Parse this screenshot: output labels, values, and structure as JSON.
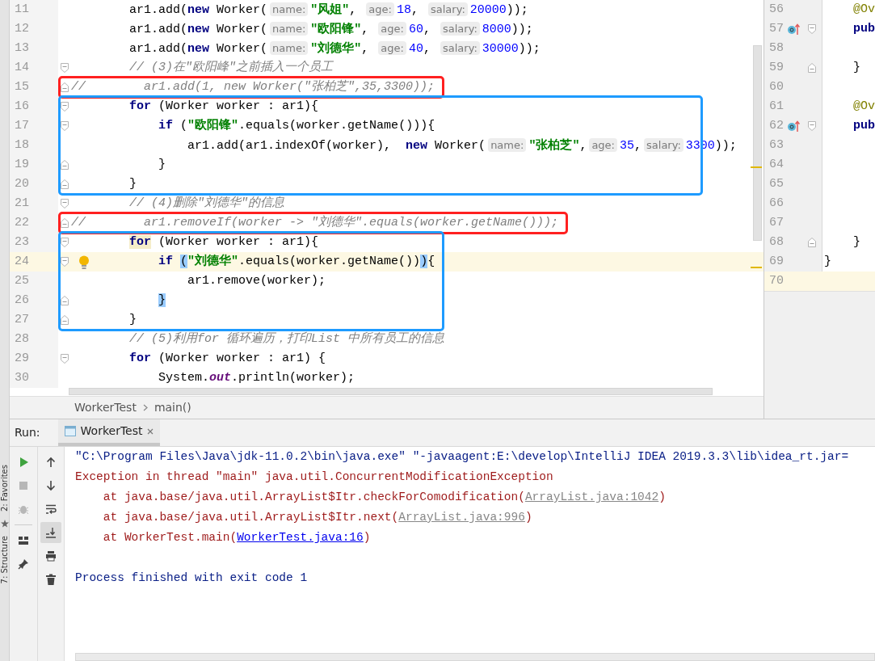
{
  "editor": {
    "blocks": [
      {
        "lines": [
          {
            "number": "11",
            "current": false,
            "tokens": [
              {
                "kind": "plain",
                "text": "        ar1.add("
              },
              {
                "kind": "keyword",
                "text": "new"
              },
              {
                "kind": "plain",
                "text": " Worker("
              },
              {
                "kind": "hint",
                "text": "name:"
              },
              {
                "kind": "string",
                "text": "\"风姐\""
              },
              {
                "kind": "plain",
                "text": ", "
              },
              {
                "kind": "hint",
                "text": "age:"
              },
              {
                "kind": "number",
                "text": "18"
              },
              {
                "kind": "plain",
                "text": ", "
              },
              {
                "kind": "hint",
                "text": "salary:"
              },
              {
                "kind": "number",
                "text": "20000"
              },
              {
                "kind": "plain",
                "text": "));"
              }
            ]
          },
          {
            "number": "12",
            "current": false,
            "tokens": [
              {
                "kind": "plain",
                "text": "        ar1.add("
              },
              {
                "kind": "keyword",
                "text": "new"
              },
              {
                "kind": "plain",
                "text": " Worker("
              },
              {
                "kind": "hint",
                "text": "name:"
              },
              {
                "kind": "string",
                "text": "\"欧阳锋\""
              },
              {
                "kind": "plain",
                "text": ", "
              },
              {
                "kind": "hint",
                "text": "age:"
              },
              {
                "kind": "number",
                "text": "60"
              },
              {
                "kind": "plain",
                "text": ", "
              },
              {
                "kind": "hint",
                "text": "salary:"
              },
              {
                "kind": "number",
                "text": "8000"
              },
              {
                "kind": "plain",
                "text": "));"
              }
            ]
          },
          {
            "number": "13",
            "current": false,
            "tokens": [
              {
                "kind": "plain",
                "text": "        ar1.add("
              },
              {
                "kind": "keyword",
                "text": "new"
              },
              {
                "kind": "plain",
                "text": " Worker("
              },
              {
                "kind": "hint",
                "text": "name:"
              },
              {
                "kind": "string",
                "text": "\"刘德华\""
              },
              {
                "kind": "plain",
                "text": ", "
              },
              {
                "kind": "hint",
                "text": "age:"
              },
              {
                "kind": "number",
                "text": "40"
              },
              {
                "kind": "plain",
                "text": ", "
              },
              {
                "kind": "hint",
                "text": "salary:"
              },
              {
                "kind": "number",
                "text": "30000"
              },
              {
                "kind": "plain",
                "text": "));"
              }
            ]
          },
          {
            "number": "14",
            "current": false,
            "fold": {
              "kind": "start"
            },
            "tokens": [
              {
                "kind": "comment",
                "text": "        // (3)在\"欧阳峰\"之前插入一个员工"
              }
            ]
          }
        ]
      },
      {
        "color": "#ff2020",
        "lines": [
          {
            "number": "15",
            "current": false,
            "fold": {
              "kind": "end"
            },
            "tokens": [
              {
                "kind": "comment",
                "text": "//        ar1.add(1, new Worker(\"张柏芝\",35,3300));"
              }
            ]
          }
        ]
      },
      {
        "color": "#1e9bff",
        "lines": [
          {
            "number": "16",
            "current": false,
            "fold": {
              "kind": "start"
            },
            "tokens": [
              {
                "kind": "keyword",
                "text": "        for"
              },
              {
                "kind": "plain",
                "text": " (Worker worker : ar1){"
              }
            ]
          },
          {
            "number": "17",
            "current": false,
            "fold": {
              "kind": "start"
            },
            "tokens": [
              {
                "kind": "keyword",
                "text": "            if"
              },
              {
                "kind": "plain",
                "text": " ("
              },
              {
                "kind": "string",
                "text": "\"欧阳锋\""
              },
              {
                "kind": "plain",
                "text": ".equals(worker.getName())){"
              }
            ]
          },
          {
            "number": "18",
            "current": false,
            "tokens": [
              {
                "kind": "plain",
                "text": "                ar1.add(ar1.indexOf(worker),  "
              },
              {
                "kind": "keyword",
                "text": "new"
              },
              {
                "kind": "plain",
                "text": " Worker("
              },
              {
                "kind": "hint",
                "text": "name:"
              },
              {
                "kind": "string",
                "text": "\"张柏芝\""
              },
              {
                "kind": "plain",
                "text": ","
              },
              {
                "kind": "hint",
                "text": "age:"
              },
              {
                "kind": "number",
                "text": "35"
              },
              {
                "kind": "plain",
                "text": ","
              },
              {
                "kind": "hint",
                "text": "salary:"
              },
              {
                "kind": "number",
                "text": "3300"
              },
              {
                "kind": "plain",
                "text": "));"
              }
            ]
          },
          {
            "number": "19",
            "current": false,
            "fold": {
              "kind": "end"
            },
            "tokens": [
              {
                "kind": "plain",
                "text": "            }"
              }
            ]
          },
          {
            "number": "20",
            "current": false,
            "fold": {
              "kind": "end"
            },
            "tokens": [
              {
                "kind": "plain",
                "text": "        }"
              }
            ]
          }
        ]
      },
      {
        "lines": [
          {
            "number": "21",
            "current": false,
            "fold": {
              "kind": "start"
            },
            "tokens": [
              {
                "kind": "comment",
                "text": "        // (4)删除\"刘德华\"的信息"
              }
            ]
          }
        ]
      },
      {
        "color": "#ff2020",
        "lines": [
          {
            "number": "22",
            "current": false,
            "fold": {
              "kind": "end"
            },
            "tokens": [
              {
                "kind": "comment",
                "text": "//        ar1.removeIf(worker -> \"刘德华\".equals(worker.getName()));"
              }
            ]
          }
        ]
      },
      {
        "color": "#1e9bff",
        "lines": [
          {
            "number": "23",
            "current": false,
            "fold": {
              "kind": "start"
            },
            "tokens": [
              {
                "kind": "keyword-marked",
                "text": "        for"
              },
              {
                "kind": "plain",
                "text": " (Worker worker : ar1){"
              }
            ]
          },
          {
            "number": "24",
            "current": true,
            "fold": {
              "kind": "start"
            },
            "gutter_icon": {
              "kind": "bulb"
            },
            "tokens": [
              {
                "kind": "keyword",
                "text": "            if "
              },
              {
                "kind": "match",
                "text": "("
              },
              {
                "kind": "string",
                "text": "\"刘德华\""
              },
              {
                "kind": "plain",
                "text": ".equals(worker.getName())"
              },
              {
                "kind": "match",
                "text": ")"
              },
              {
                "kind": "plain",
                "text": "{"
              }
            ]
          },
          {
            "number": "25",
            "current": false,
            "tokens": [
              {
                "kind": "plain",
                "text": "                ar1.remove(worker);"
              }
            ]
          },
          {
            "number": "26",
            "current": false,
            "fold": {
              "kind": "end"
            },
            "tokens": [
              {
                "kind": "match",
                "text": "            }"
              }
            ]
          },
          {
            "number": "27",
            "current": false,
            "fold": {
              "kind": "end"
            },
            "tokens": [
              {
                "kind": "plain",
                "text": "        }"
              }
            ]
          }
        ]
      },
      {
        "lines": [
          {
            "number": "28",
            "current": false,
            "tokens": [
              {
                "kind": "comment",
                "text": "        // (5)利用for 循环遍历，打印List 中所有员工的信息"
              }
            ]
          },
          {
            "number": "29",
            "current": false,
            "fold": {
              "kind": "start"
            },
            "tokens": [
              {
                "kind": "keyword",
                "text": "        for"
              },
              {
                "kind": "plain",
                "text": " (Worker worker : ar1) {"
              }
            ]
          },
          {
            "number": "30",
            "current": false,
            "tokens": [
              {
                "kind": "plain",
                "text": "            System."
              },
              {
                "kind": "field",
                "text": "out"
              },
              {
                "kind": "plain",
                "text": ".println(worker);"
              }
            ]
          }
        ]
      }
    ],
    "breadcrumbs": [
      "WorkerTest",
      "main()"
    ]
  },
  "side_editor": {
    "lines": [
      {
        "number": "56",
        "current": false,
        "tokens": [
          {
            "kind": "annotation",
            "text": "    @Ov"
          }
        ]
      },
      {
        "number": "57",
        "current": false,
        "fold": {
          "kind": "start"
        },
        "gutter_icon": {
          "kind": "override"
        },
        "tokens": [
          {
            "kind": "keyword",
            "text": "    pub"
          }
        ]
      },
      {
        "number": "58",
        "current": false
      },
      {
        "number": "59",
        "current": false,
        "fold": {
          "kind": "end"
        },
        "tokens": [
          {
            "kind": "plain",
            "text": "    }"
          }
        ]
      },
      {
        "number": "60",
        "current": false
      },
      {
        "number": "61",
        "current": false,
        "tokens": [
          {
            "kind": "annotation",
            "text": "    @Ov"
          }
        ]
      },
      {
        "number": "62",
        "current": false,
        "fold": {
          "kind": "start"
        },
        "gutter_icon": {
          "kind": "override"
        },
        "tokens": [
          {
            "kind": "keyword",
            "text": "    pub"
          }
        ]
      },
      {
        "number": "63",
        "current": false
      },
      {
        "number": "64",
        "current": false
      },
      {
        "number": "65",
        "current": false
      },
      {
        "number": "66",
        "current": false
      },
      {
        "number": "67",
        "current": false
      },
      {
        "number": "68",
        "current": false,
        "fold": {
          "kind": "end"
        },
        "tokens": [
          {
            "kind": "plain",
            "text": "    }"
          }
        ]
      },
      {
        "number": "69",
        "current": false,
        "tokens": [
          {
            "kind": "plain",
            "text": "}"
          }
        ]
      },
      {
        "number": "70",
        "current": true
      }
    ]
  },
  "side_tabs": [
    {
      "label": "2: Favorites"
    },
    {
      "label": "7: Structure"
    }
  ],
  "run_panel": {
    "label": "Run:",
    "tabs": [
      {
        "title": "WorkerTest",
        "selected": true
      }
    ],
    "toolbar_left": [
      {
        "kind": "run",
        "disabled": false
      },
      {
        "kind": "stop",
        "disabled": true
      },
      {
        "kind": "debug",
        "disabled": true
      },
      {
        "kind": "layout",
        "disabled": false
      },
      {
        "kind": "pin",
        "disabled": false
      }
    ],
    "toolbar_right": [
      {
        "kind": "up",
        "on": false
      },
      {
        "kind": "down",
        "on": false
      },
      {
        "kind": "wrap",
        "on": false
      },
      {
        "kind": "scroll-end",
        "on": true
      },
      {
        "kind": "print",
        "on": false
      },
      {
        "kind": "trash",
        "on": false
      }
    ],
    "console": [
      {
        "kind": "command",
        "segments": [
          {
            "text": "\"C:\\Program Files\\Java\\jdk-11.0.2\\bin\\java.exe\" \"-javaagent:E:\\develop\\IntelliJ IDEA 2019.3.3\\lib\\idea_rt.jar="
          }
        ]
      },
      {
        "kind": "error",
        "segments": [
          {
            "text": "Exception in thread \"main\" java.util.ConcurrentModificationException"
          }
        ]
      },
      {
        "kind": "error",
        "segments": [
          {
            "text": "    at java.base/java.util.ArrayList$Itr.checkForComodification("
          },
          {
            "text": "ArrayList.java:1042",
            "link": {
              "kind": "library"
            }
          },
          {
            "text": ")"
          }
        ]
      },
      {
        "kind": "error",
        "segments": [
          {
            "text": "    at java.base/java.util.ArrayList$Itr.next("
          },
          {
            "text": "ArrayList.java:996",
            "link": {
              "kind": "library"
            }
          },
          {
            "text": ")"
          }
        ]
      },
      {
        "kind": "error",
        "segments": [
          {
            "text": "    at WorkerTest.main("
          },
          {
            "text": "WorkerTest.java:16",
            "link": {
              "kind": "source"
            }
          },
          {
            "text": ")"
          }
        ]
      },
      {
        "kind": "blank"
      },
      {
        "kind": "command",
        "segments": [
          {
            "text": "Process finished with exit code 1"
          }
        ]
      }
    ]
  }
}
